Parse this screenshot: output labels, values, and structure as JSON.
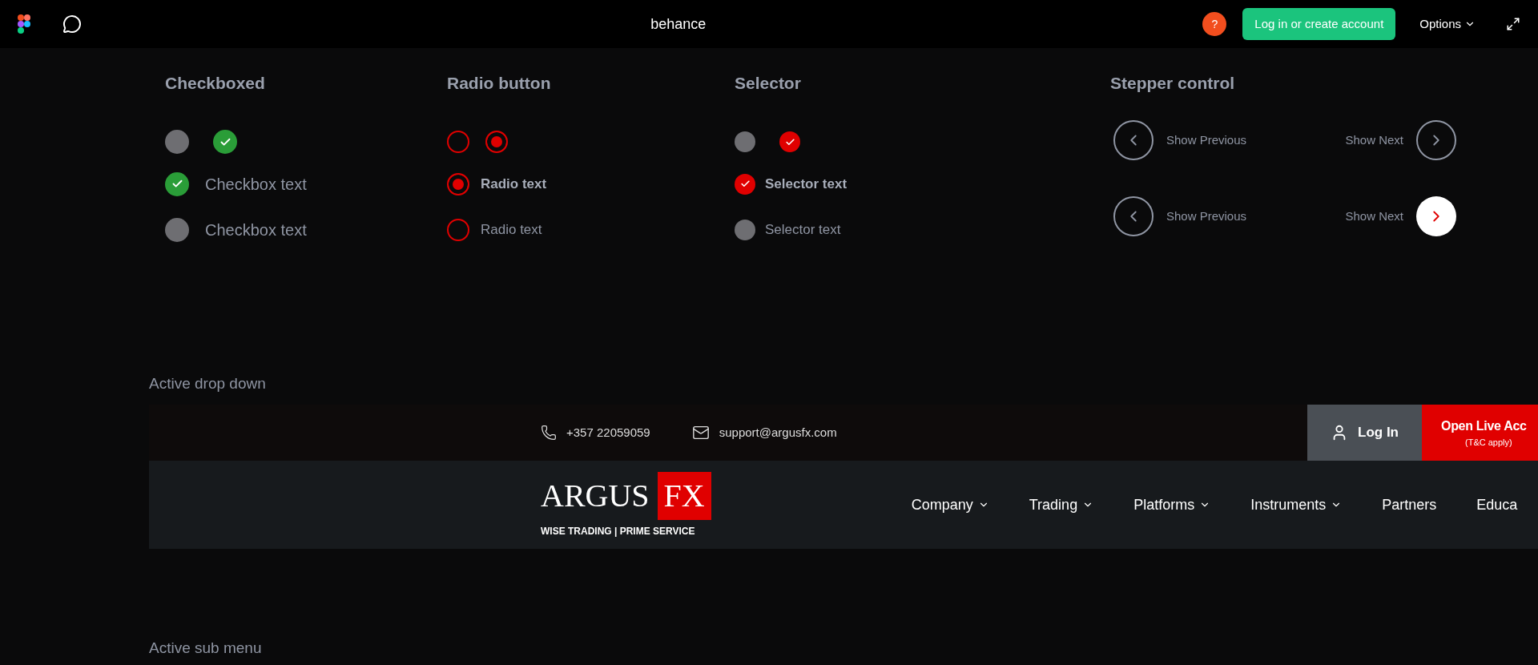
{
  "topbar": {
    "title": "behance",
    "help": "?",
    "login_button": "Log in or create account",
    "options": "Options"
  },
  "checkboxes": {
    "title": "Checkboxed",
    "samples": [
      {
        "checked": false
      },
      {
        "checked": true
      }
    ],
    "items": [
      {
        "label": "Checkbox text",
        "checked": true
      },
      {
        "label": "Checkbox text",
        "checked": false
      }
    ]
  },
  "radios": {
    "title": "Radio button",
    "samples": [
      {
        "selected": false
      },
      {
        "selected": true
      }
    ],
    "items": [
      {
        "label": "Radio text",
        "selected": true
      },
      {
        "label": "Radio text",
        "selected": false
      }
    ]
  },
  "selectors": {
    "title": "Selector",
    "samples": [
      {
        "checked": false
      },
      {
        "checked": true
      }
    ],
    "items": [
      {
        "label": "Selector text",
        "checked": true
      },
      {
        "label": "Selector text",
        "checked": false
      }
    ]
  },
  "stepper": {
    "title": "Stepper control",
    "rows": [
      {
        "previous": "Show Previous",
        "next": "Show Next",
        "next_active": false
      },
      {
        "previous": "Show Previous",
        "next": "Show Next",
        "next_active": true
      }
    ]
  },
  "dropdown_section": {
    "title": "Active drop down",
    "contact": {
      "phone": "+357 22059059",
      "email": "support@argusfx.com"
    },
    "login": "Log In",
    "open_account": "Open Live Acc",
    "open_account_note": "(T&C apply)",
    "logo": {
      "name": "ARGUS",
      "badge": "FX",
      "tagline": "WISE TRADING | PRIME SERVICE"
    },
    "nav": [
      {
        "label": "Company",
        "has_menu": true
      },
      {
        "label": "Trading",
        "has_menu": true
      },
      {
        "label": "Platforms",
        "has_menu": true
      },
      {
        "label": "Instruments",
        "has_menu": true
      },
      {
        "label": "Partners",
        "has_menu": false
      },
      {
        "label": "Educa",
        "has_menu": false
      }
    ]
  },
  "submenu_section": {
    "title": "Active sub menu"
  }
}
